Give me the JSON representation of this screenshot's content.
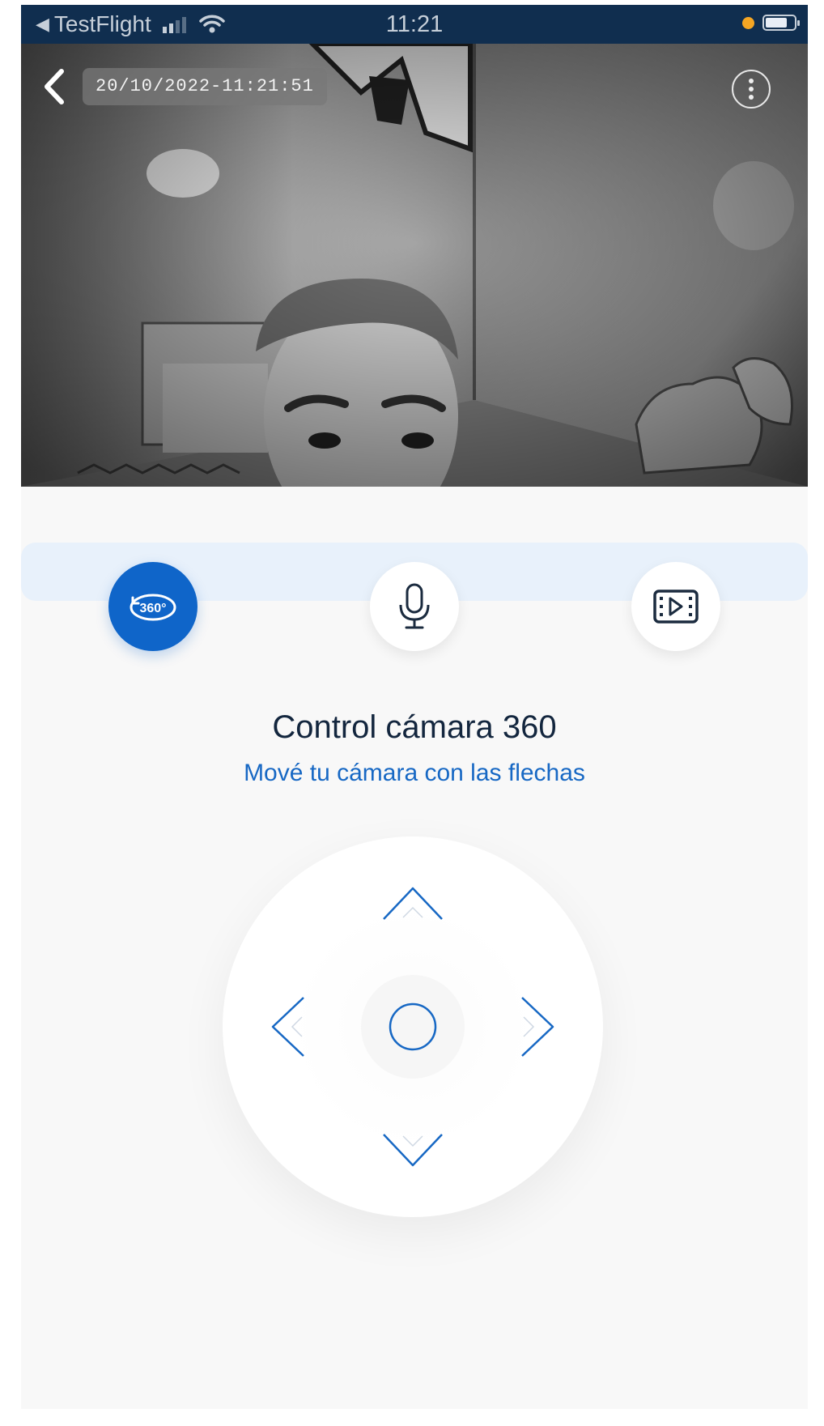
{
  "status_bar": {
    "back_app": "TestFlight",
    "time": "11:21"
  },
  "camera_feed": {
    "timestamp": "20/10/2022-11:21:51"
  },
  "actions": [
    {
      "name": "camera-360",
      "badge": "360°",
      "active": true
    },
    {
      "name": "microphone",
      "active": false
    },
    {
      "name": "recordings",
      "active": false
    }
  ],
  "control": {
    "title": "Control cámara 360",
    "subtitle": "Mové tu cámara con las flechas"
  },
  "colors": {
    "accent": "#0f65c9",
    "title": "#13263e",
    "subtitle": "#1768c4",
    "strip": "#e8f1fb",
    "status_bar": "#102e4f"
  }
}
